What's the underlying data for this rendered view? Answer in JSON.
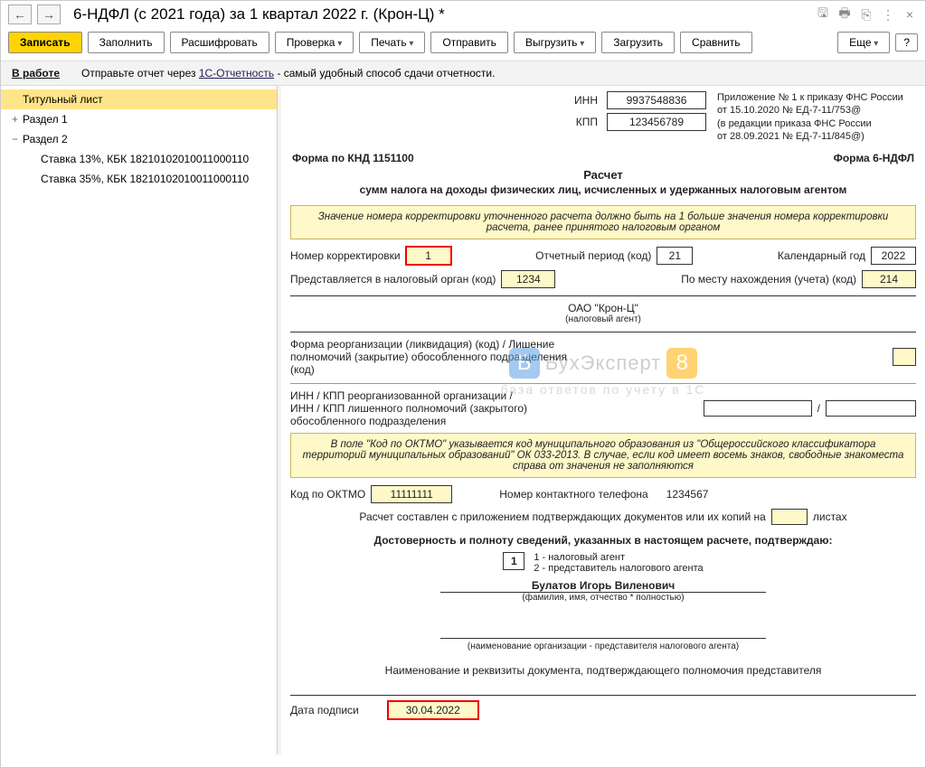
{
  "window": {
    "title": "6-НДФЛ (с 2021 года) за 1 квартал 2022 г. (Крон-Ц) *"
  },
  "toolbar": {
    "write": "Записать",
    "fill": "Заполнить",
    "decode": "Расшифровать",
    "check": "Проверка",
    "print": "Печать",
    "send": "Отправить",
    "export": "Выгрузить",
    "import": "Загрузить",
    "compare": "Сравнить",
    "more": "Еще",
    "help": "?"
  },
  "tip": {
    "status": "В работе",
    "text_pre": "Отправьте отчет через ",
    "link": "1С-Отчетность",
    "text_post": " - самый удобный способ сдачи отчетности."
  },
  "tree": {
    "items": [
      {
        "label": "Титульный лист",
        "selected": true
      },
      {
        "label": "Раздел 1",
        "expandable": "+"
      },
      {
        "label": "Раздел 2",
        "expandable": "−"
      },
      {
        "label": "Ставка 13%, КБК 18210102010011000110",
        "child": true
      },
      {
        "label": "Ставка 35%, КБК 18210102010011000110",
        "child": true
      }
    ]
  },
  "form": {
    "inn_label": "ИНН",
    "inn": "9937548836",
    "kpp_label": "КПП",
    "kpp": "123456789",
    "appx1": "Приложение № 1 к приказу ФНС России",
    "appx2": "от 15.10.2020 № ЕД-7-11/753@",
    "appx3": "(в редакции приказа ФНС России",
    "appx4": "от 28.09.2021 № ЕД-7-11/845@)",
    "knd": "Форма по КНД 1151100",
    "form6": "Форма 6-НДФЛ",
    "title": "Расчет",
    "subtitle": "сумм налога на доходы физических лиц, исчисленных и удержанных налоговым агентом",
    "note1": "Значение номера корректировки уточненного расчета должно быть на 1 больше значения номера корректировки расчета, ранее принятого налоговым органом",
    "corr_label": "Номер корректировки",
    "corr": "1",
    "period_label": "Отчетный период (код)",
    "period": "21",
    "year_label": "Календарный год",
    "year": "2022",
    "tax_org_label": "Представляется в налоговый орган (код)",
    "tax_org": "1234",
    "loc_label": "По месту нахождения (учета) (код)",
    "loc": "214",
    "org": "ОАО \"Крон-Ц\"",
    "org_sub": "(налоговый агент)",
    "reorg_label": "Форма реорганизации (ликвидация) (код) / Лишение полномочий (закрытие) обособленного подразделения (код)",
    "inn_kpp_label": "ИНН / КПП реорганизованной организации /\nИНН / КПП лишенного полномочий (закрытого) обособленного подразделения",
    "note2": "В поле \"Код по ОКТМО\" указывается код муниципального образования из \"Общероссийского классификатора территорий муниципальных образований\" ОК 033-2013. В случае, если код имеет восемь знаков, свободные знакоместа справа от значения не заполняются",
    "oktmo_label": "Код по ОКТМО",
    "oktmo": "11111111",
    "phone_label": "Номер контактного телефона",
    "phone": "1234567",
    "pages_label_pre": "Расчет составлен с приложением подтверждающих документов или их копий на",
    "pages_label_post": "листах",
    "confirm": "Достоверность и полноту сведений, указанных в настоящем расчете, подтверждаю:",
    "signer_code": "1",
    "signer_opt1": "1 - налоговый агент",
    "signer_opt2": "2 - представитель налогового агента",
    "fio": "Булатов Игорь Виленович",
    "fio_sub": "(фамилия, имя, отчество * полностью)",
    "rep_org_sub": "(наименование организации - представителя налогового агента)",
    "doc_label": "Наименование и реквизиты документа, подтверждающего полномочия представителя",
    "date_label": "Дата подписи",
    "date": "30.04.2022"
  },
  "watermark": {
    "brand": "БухЭксперт",
    "sub": "база ответов по учету в 1С"
  }
}
